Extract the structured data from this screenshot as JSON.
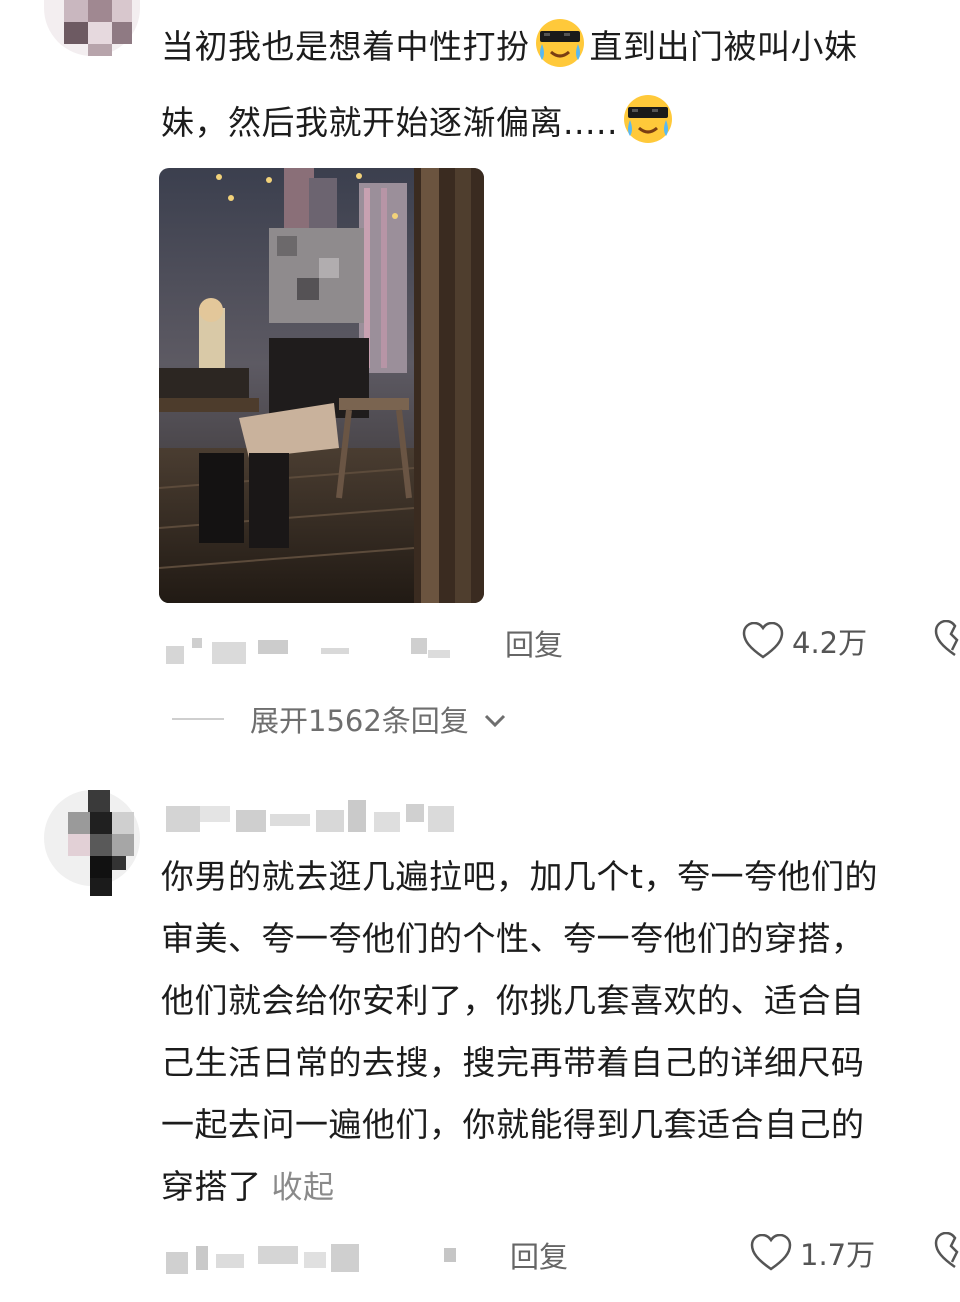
{
  "comments": [
    {
      "text_lines": [
        "当初我也是想着中性打扮",
        "直到出门被叫小妹",
        "妹，然后我就开始逐渐偏离....."
      ],
      "emoji": "cool-crying-sunglasses-emoji",
      "photo": "blurred-outdoor-night-rooftop-photo",
      "reply_label": "回复",
      "likes": "4.2万",
      "expand_label": "展开1562条回复"
    },
    {
      "text_lines": [
        "你男的就去逛几遍拉吧，加几个t，夸一夸他们的",
        "审美、夸一夸他们的个性、夸一夸他们的穿搭，",
        "他们就会给你安利了，你挑几套喜欢的、适合自",
        "己生活日常的去搜，搜完再带着自己的详细尺码",
        "一起去问一遍他们，你就能得到几套适合自己的",
        "穿搭了"
      ],
      "collapse_label": "收起",
      "reply_label": "回复",
      "likes": "1.7万"
    }
  ],
  "colors": {
    "text": "#1c1c1c",
    "secondary": "#8a8a8a",
    "meta": "#666666"
  }
}
